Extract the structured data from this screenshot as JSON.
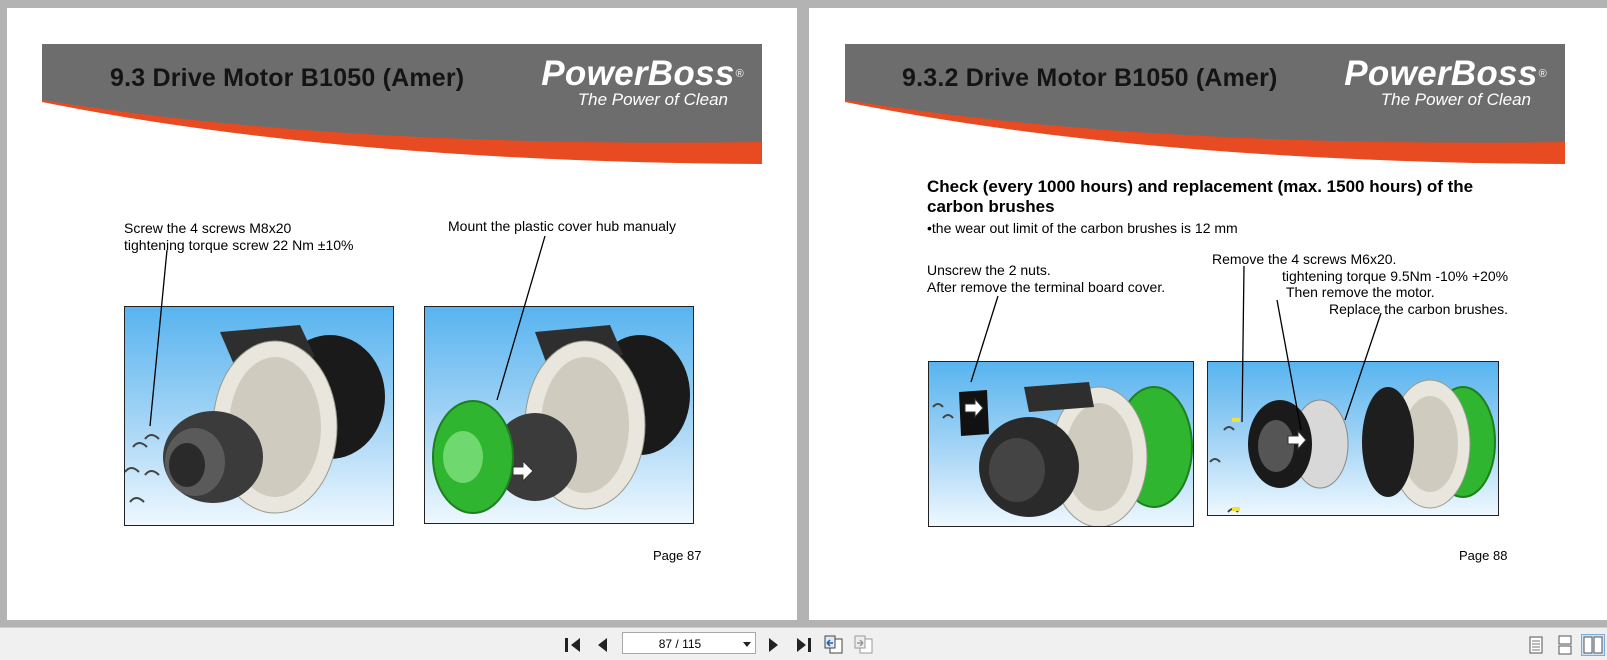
{
  "pages": [
    {
      "title": "9.3   Drive Motor B1050 (Amer)",
      "brand": "PowerBoss",
      "brand_mark": "®",
      "tagline": "The Power of Clean",
      "notes": {
        "left_line1": "Screw the 4 screws M8x20",
        "left_line2": "tightening torque screw 22 Nm ±10%",
        "right_line1": "Mount the plastic cover hub manualy"
      },
      "page_label": "Page 87"
    },
    {
      "title": "9.3.2 Drive Motor B1050 (Amer)",
      "brand": "PowerBoss",
      "brand_mark": "®",
      "tagline": "The Power of Clean",
      "heading_line1": "Check (every 1000 hours) and replacement (max. 1500 hours) of the",
      "heading_line2": "carbon brushes",
      "subnote": "•the wear out limit of the carbon brushes is 12 mm",
      "notes": {
        "left_line1": "Unscrew the 2 nuts.",
        "left_line2": "After remove the terminal board cover.",
        "right_line1": "Remove the 4 screws M6x20.",
        "right_line2": "tightening torque 9.5Nm -10% +20%",
        "right_line3": "Then remove the motor.",
        "right_line4": "Replace the carbon brushes."
      },
      "page_label": "Page 88"
    }
  ],
  "toolbar": {
    "page_indicator": "87 / 115",
    "current_page": 87,
    "total_pages": 115
  },
  "colors": {
    "banner_gray": "#6d6d6d",
    "banner_orange": "#e84b22",
    "background": "#b3b3b3",
    "motor_green": "#2fb52f"
  }
}
